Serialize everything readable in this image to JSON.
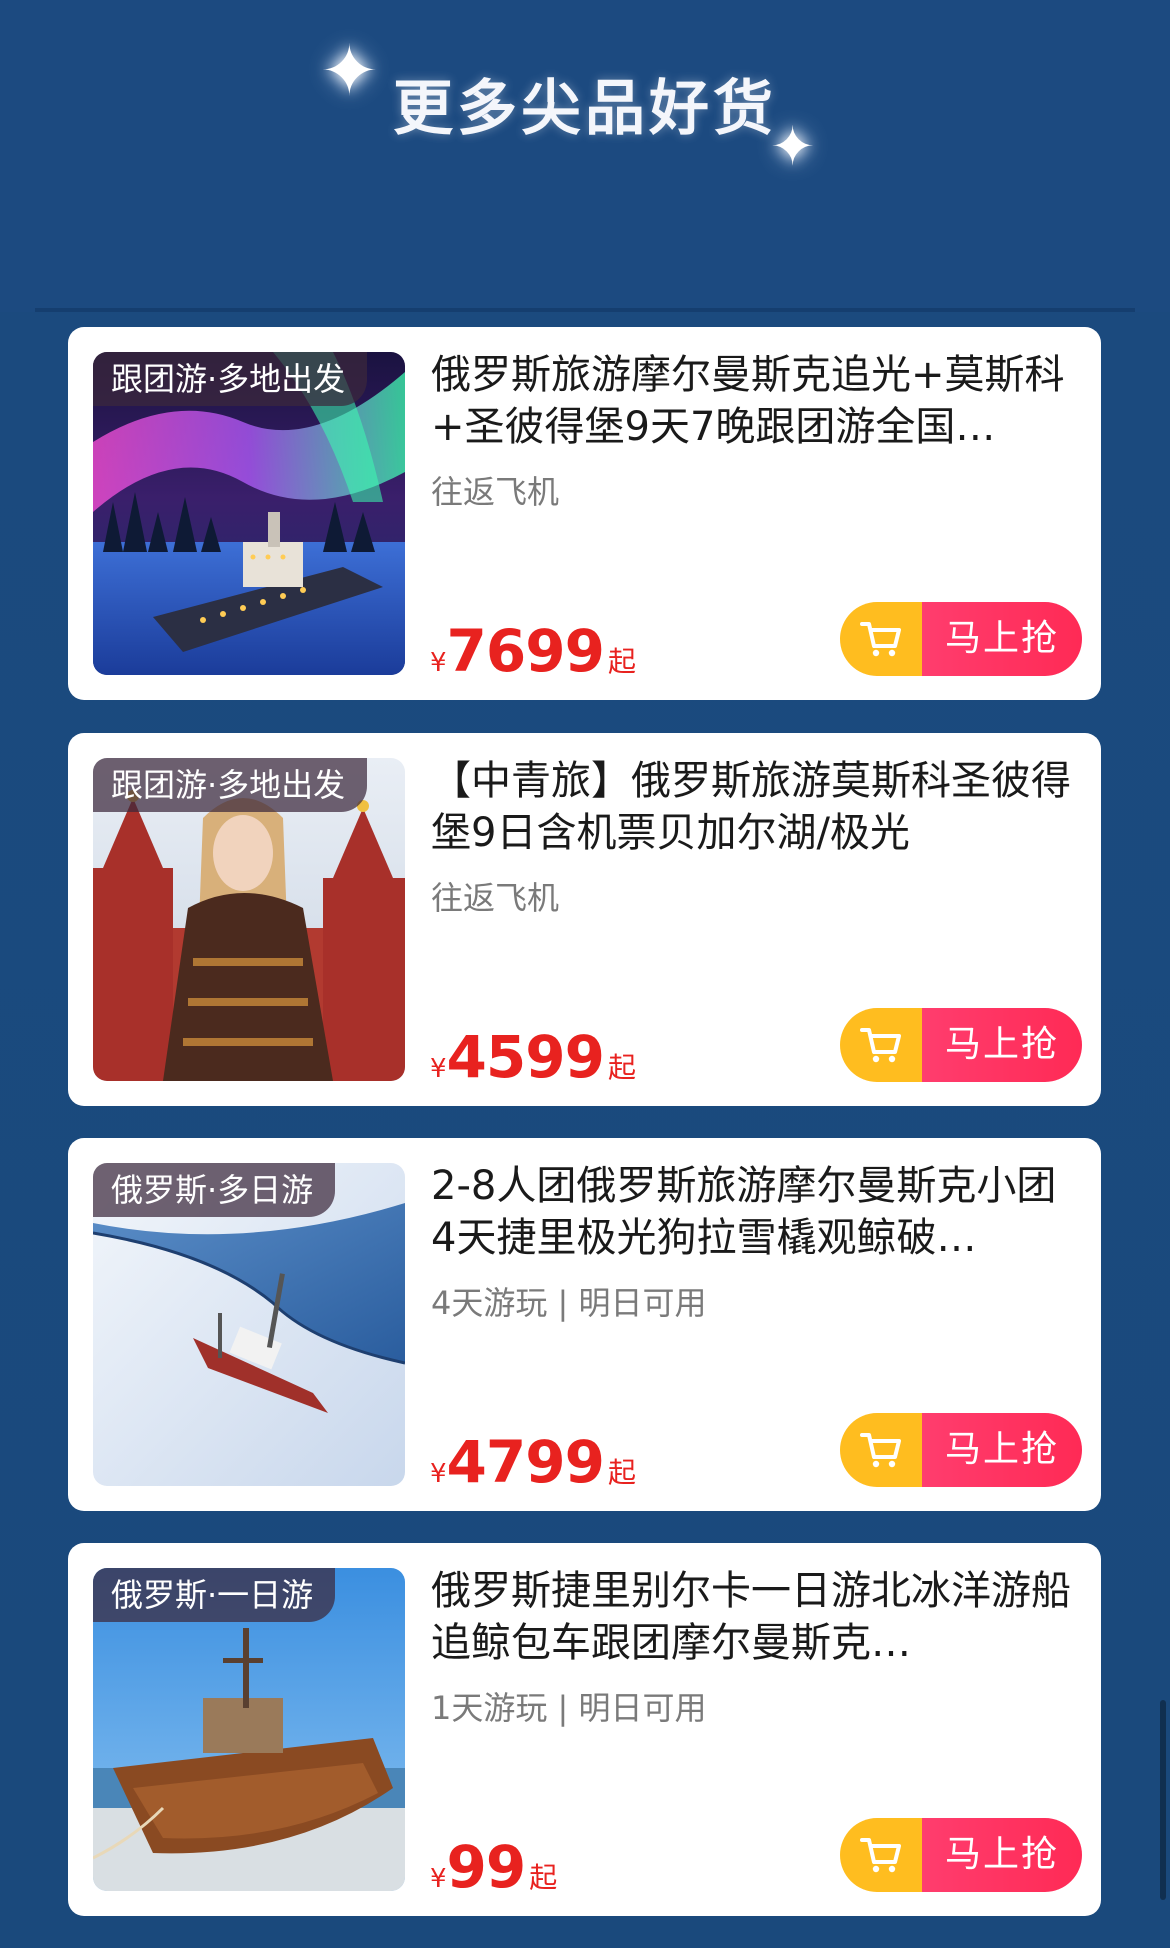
{
  "section": {
    "title": "更多尖品好货"
  },
  "products": [
    {
      "tag": "跟团游·多地出发",
      "title": "俄罗斯旅游摩尔曼斯克追光+莫斯科+圣彼得堡9天7晚跟团游全国…",
      "sub": "往返飞机",
      "currency": "¥",
      "price": "7699",
      "price_suffix": "起",
      "buy_label": "马上抢",
      "image": "aurora-icebreaker-ship"
    },
    {
      "tag": "跟团游·多地出发",
      "title": "【中青旅】俄罗斯旅游莫斯科圣彼得堡9日含机票贝加尔湖/极光",
      "sub": "往返飞机",
      "currency": "¥",
      "price": "4599",
      "price_suffix": "起",
      "buy_label": "马上抢",
      "image": "woman-red-square"
    },
    {
      "tag": "俄罗斯·多日游",
      "title": "2-8人团俄罗斯旅游摩尔曼斯克小团4天捷里极光狗拉雪橇观鲸破…",
      "sub": "4天游玩 | 明日可用",
      "currency": "¥",
      "price": "4799",
      "price_suffix": "起",
      "buy_label": "马上抢",
      "image": "ship-in-ice-aerial"
    },
    {
      "tag": "俄罗斯·一日游",
      "title": "俄罗斯捷里别尔卡一日游北冰洋游船追鲸包车跟团摩尔曼斯克…",
      "sub": "1天游玩 | 明日可用",
      "currency": "¥",
      "price": "99",
      "price_suffix": "起",
      "buy_label": "马上抢",
      "image": "rusted-shipwreck-beach"
    }
  ],
  "colors": {
    "background": "#1b4a7f",
    "price": "#e8221f",
    "cart_button": "#ffbd1f",
    "buy_button": "#ff2a55"
  }
}
